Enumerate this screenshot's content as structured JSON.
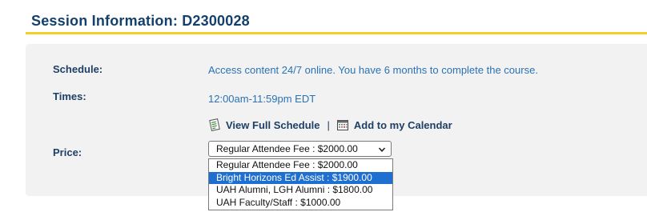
{
  "session": {
    "title": "Session Information: D2300028"
  },
  "details": {
    "schedule_label": "Schedule:",
    "schedule_value": "Access content 24/7 online. You have 6 months to complete the course.",
    "times_label": "Times:",
    "times_value": "12:00am-11:59pm EDT",
    "price_label": "Price:"
  },
  "links": {
    "view_schedule": "View Full Schedule",
    "separator": "|",
    "add_calendar": "Add to my Calendar"
  },
  "price_select": {
    "selected": "Regular Attendee Fee : $2000.00",
    "options": [
      "Regular Attendee Fee : $2000.00",
      "Bright Horizons Ed Assist : $1900.00",
      "UAH Alumni, LGH Alumni : $1800.00",
      "UAH Faculty/Staff : $1000.00"
    ],
    "highlighted_index": 1
  },
  "colors": {
    "title": "#14406b",
    "accent_rule": "#f2cf2a",
    "link_value": "#2a72b5",
    "highlight": "#1f6fd0"
  }
}
